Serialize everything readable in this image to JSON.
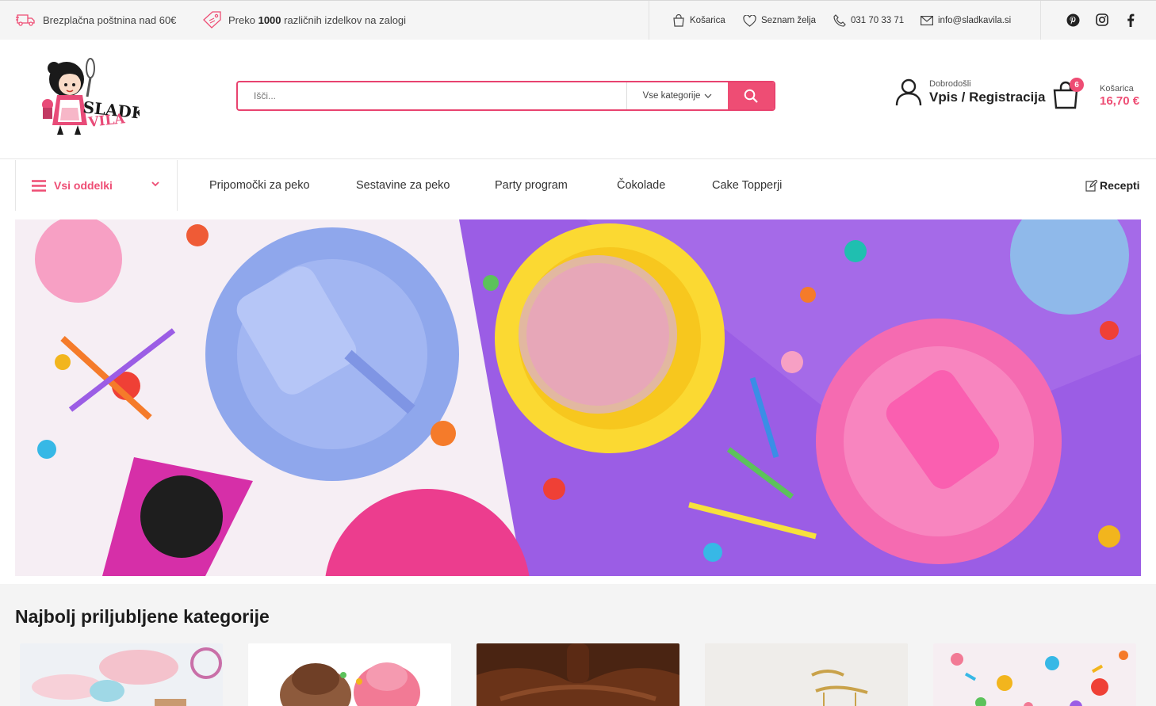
{
  "topbar": {
    "shipping_text": "Brezplačna poštnina nad 60€",
    "stock_prefix": "Preko",
    "stock_bold": "1000",
    "stock_suffix": "različnih izdelkov na zalogi",
    "cart_link": "Košarica",
    "wishlist_link": "Seznam želja",
    "phone": "031 70 33 71",
    "email": "info@sladkavila.si",
    "social": [
      "pinterest-icon",
      "instagram-icon",
      "facebook-icon"
    ]
  },
  "header": {
    "logo_text_1": "SLADKA",
    "logo_text_2": "VILA",
    "search_placeholder": "Išči...",
    "search_category": "Vse kategorije",
    "account_small": "Dobrodošli",
    "account_big": "Vpis / Registracija",
    "cart_count": "6",
    "cart_label": "Košarica",
    "cart_price": "16,70 €"
  },
  "nav": {
    "departments_label": "Vsi oddelki",
    "links": [
      "Pripomočki za peko",
      "Sestavine za peko",
      "Party program",
      "Čokolade",
      "Cake Topperji"
    ],
    "recepti": "Recepti"
  },
  "categories": {
    "title": "Najbolj priljubljene kategorije"
  },
  "colors": {
    "accent": "#ee4d74",
    "topbar_bg": "#f5f5f5",
    "section_bg": "#f4f4f4"
  }
}
